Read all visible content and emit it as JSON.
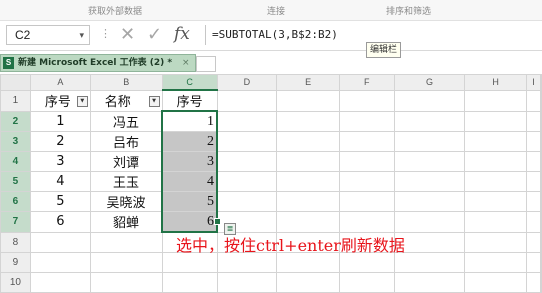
{
  "ribbon": {
    "groups": [
      "获取外部数据",
      "连接",
      "排序和筛选"
    ]
  },
  "formula_bar": {
    "name_box": "C2",
    "name_dropdown_glyph": "▾",
    "dots_glyph": "⋮",
    "cancel_glyph": "✕",
    "enter_glyph": "✓",
    "fx_label": "fx",
    "formula": "=SUBTOTAL(3,B$2:B2)",
    "tooltip": "编辑栏"
  },
  "document_tab": {
    "icon_letter": "S",
    "title": "新建 Microsoft Excel 工作表 (2) *",
    "close_glyph": "×"
  },
  "sheet": {
    "columns": [
      "A",
      "B",
      "C",
      "D",
      "E",
      "F",
      "G",
      "H",
      "I"
    ],
    "selected_column": "C",
    "rows": [
      "1",
      "2",
      "3",
      "4",
      "5",
      "6",
      "7",
      "8",
      "9",
      "10"
    ],
    "header_row": {
      "a": "序号",
      "b": "名称",
      "c": "序号",
      "filter_glyph": "▼"
    },
    "data": [
      {
        "a": "1",
        "b": "冯五",
        "c": "1"
      },
      {
        "a": "2",
        "b": "吕布",
        "c": "2"
      },
      {
        "a": "3",
        "b": "刘谭",
        "c": "3"
      },
      {
        "a": "4",
        "b": "王玉",
        "c": "4"
      },
      {
        "a": "5",
        "b": "吴晓波",
        "c": "5"
      },
      {
        "a": "6",
        "b": "貂蝉",
        "c": "6"
      }
    ],
    "quick_analysis_glyph": "≣"
  },
  "annotation": "选中，按住ctrl+enter刷新数据",
  "colors": {
    "accent": "#217346",
    "selection_fill": "#c6c6c6",
    "annotation": "#e8141b"
  }
}
